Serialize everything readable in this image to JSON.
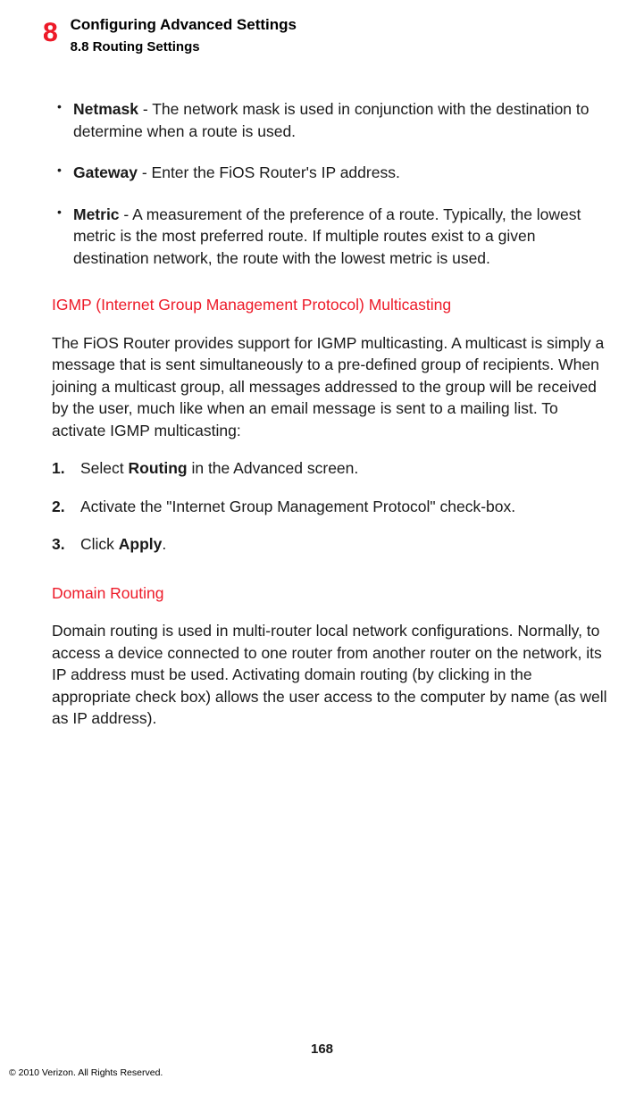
{
  "header": {
    "chapter_number": "8",
    "chapter_title": "Configuring Advanced Settings",
    "section_title": "8.8 Routing Settings"
  },
  "bullets": [
    {
      "term": "Netmask",
      "desc": " - The network mask is used in conjunction with the destination to determine when a route is used."
    },
    {
      "term": "Gateway",
      "desc": " - Enter the FiOS Router's IP address."
    },
    {
      "term": "Metric",
      "desc": " - A measurement of the preference of a route. Typically, the lowest metric is the most preferred route. If multiple routes exist to a given destination network, the route with the lowest metric is used."
    }
  ],
  "igmp": {
    "heading": "IGMP (Internet Group Management Protocol) Multicasting",
    "intro": "The FiOS Router provides support for IGMP multicasting. A multicast is simply a message that is sent simultaneously to a pre-defined group of recipients. When joining a multicast group, all messages addressed to the group will be received by the user, much like when an email message is sent to a mailing list.  To activate IGMP multicasting:",
    "steps": [
      {
        "num": "1.",
        "pre": "Select ",
        "bold": "Routing",
        "post": " in the Advanced screen."
      },
      {
        "num": "2.",
        "pre": "Activate the \"Internet Group Management Protocol\" check-box.",
        "bold": "",
        "post": ""
      },
      {
        "num": "3.",
        "pre": "Click ",
        "bold": "Apply",
        "post": "."
      }
    ]
  },
  "domain_routing": {
    "heading": "Domain Routing",
    "body": "Domain routing is used in multi-router local network configurations. Normally, to access a device connected to one router from another router on the network, its IP address must be used. Activating domain routing (by clicking in the appropriate check box) allows the user access to the computer by name (as well as IP address)."
  },
  "footer": {
    "page_number": "168",
    "copyright": "© 2010 Verizon. All Rights Reserved."
  }
}
